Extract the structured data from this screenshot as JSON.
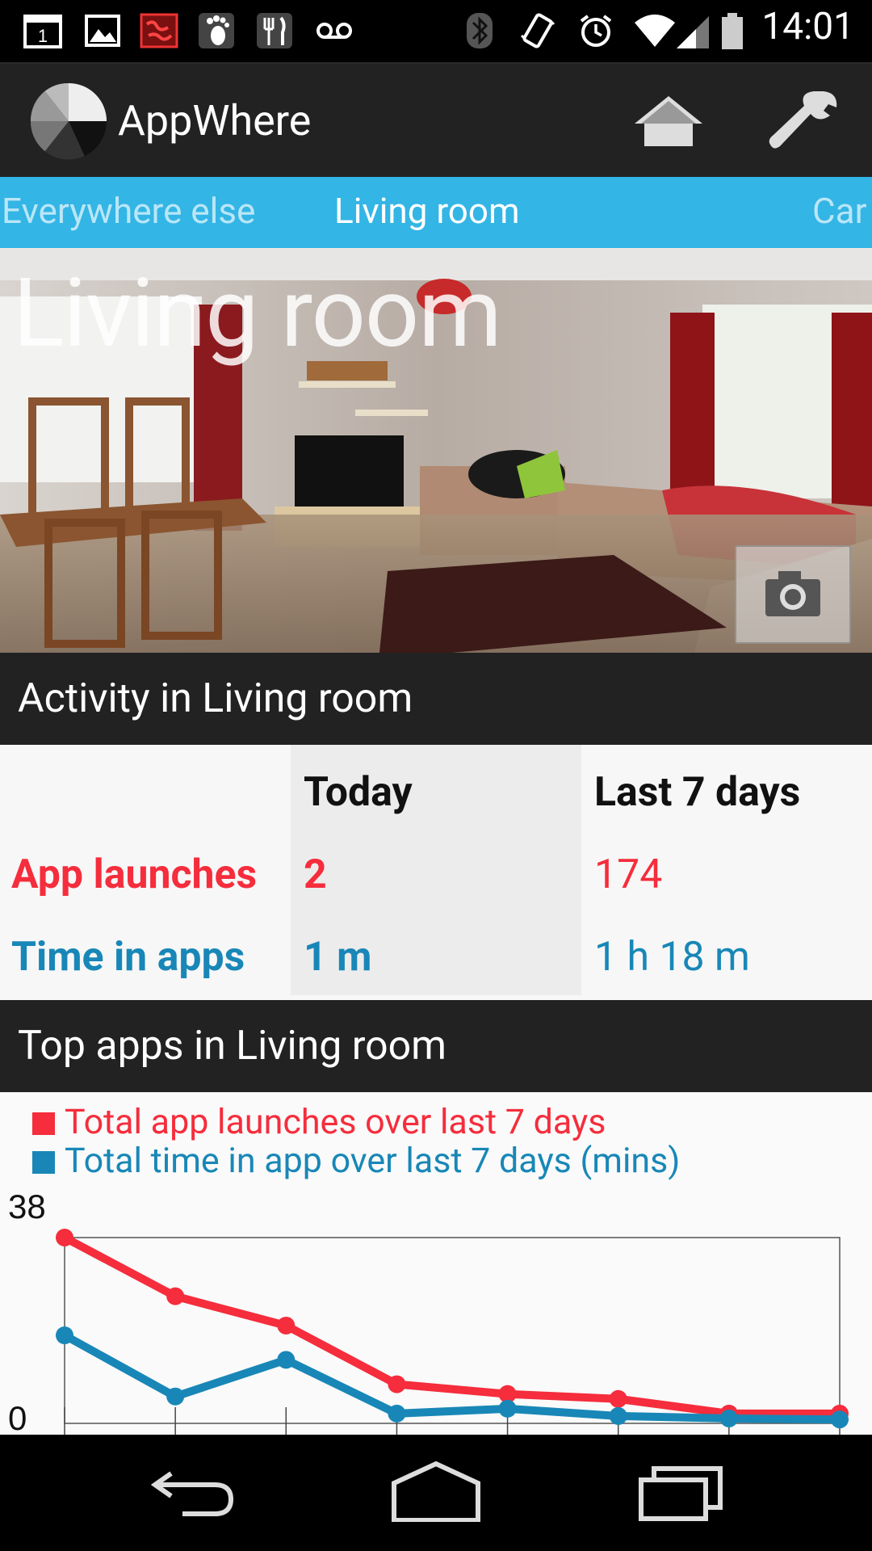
{
  "status_bar": {
    "time": "14:01",
    "notification_icons": [
      "calendar-icon",
      "image-icon",
      "map-icon",
      "footprint-icon",
      "restaurant-icon",
      "voicemail-icon"
    ],
    "system_icons": [
      "bluetooth-icon",
      "vibrate-icon",
      "alarm-icon",
      "wifi-icon",
      "signal-icon",
      "battery-icon"
    ],
    "calendar_day": "1"
  },
  "action_bar": {
    "app_title": "AppWhere",
    "home_icon": "home-icon",
    "settings_icon": "wrench-icon"
  },
  "tabs": [
    {
      "label": "Everywhere else",
      "active": false
    },
    {
      "label": "Living room",
      "active": true
    },
    {
      "label": "Car",
      "active": false
    }
  ],
  "photo": {
    "title": "Living room",
    "camera_icon": "camera-icon"
  },
  "activity": {
    "header": "Activity in Living room",
    "col_today": "Today",
    "col_week": "Last 7 days",
    "rows": [
      {
        "label": "App launches",
        "today": "2",
        "week": "174",
        "color": "#f52d3c"
      },
      {
        "label": "Time in apps",
        "today": "1 m",
        "week": "1 h 18 m",
        "color": "#1887b7"
      }
    ]
  },
  "top_apps": {
    "header": "Top apps in Living room"
  },
  "chart_data": {
    "type": "line",
    "title": "",
    "xlabel": "",
    "ylabel": "",
    "ylim": [
      0,
      38
    ],
    "y_tick_labels": [
      "38",
      "0"
    ],
    "legend_placement": "top-left",
    "x": [
      1,
      2,
      3,
      4,
      5,
      6,
      7,
      8
    ],
    "series": [
      {
        "name": "Total app launches over last 7 days",
        "color": "#f52d3c",
        "values": [
          38,
          26,
          20,
          8,
          6,
          5,
          2,
          2
        ]
      },
      {
        "name": "Total time in app over last 7 days (mins)",
        "color": "#1887b7",
        "values": [
          18,
          5.5,
          13,
          2,
          3,
          1.5,
          1,
          0.8
        ]
      }
    ]
  },
  "nav_bar": {
    "back_icon": "back-icon",
    "home_icon": "nav-home-icon",
    "recents_icon": "recents-icon"
  }
}
